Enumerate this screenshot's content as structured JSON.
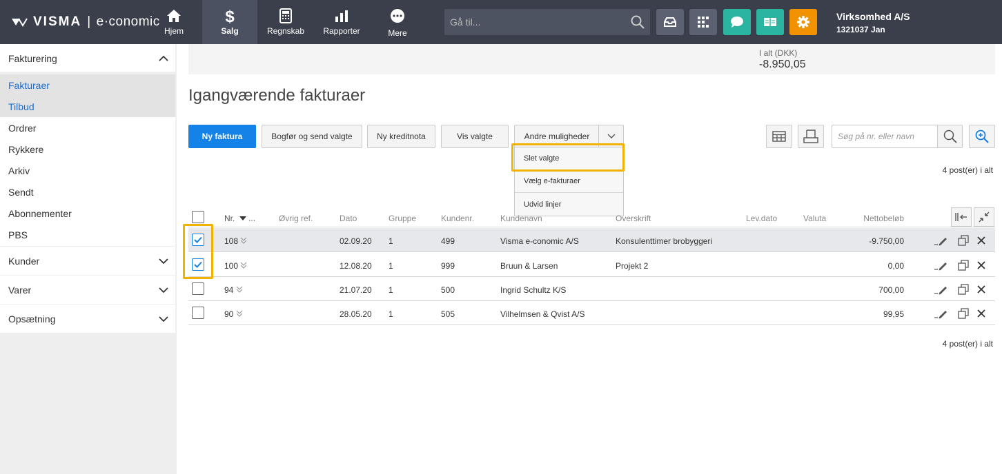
{
  "app": {
    "logo_brand": "VISMA",
    "logo_product": "e·conomic"
  },
  "topnav": {
    "items": [
      {
        "label": "Hjem",
        "icon": "home-icon"
      },
      {
        "label": "Salg",
        "icon": "dollar-icon"
      },
      {
        "label": "Regnskab",
        "icon": "calculator-icon"
      },
      {
        "label": "Rapporter",
        "icon": "bar-chart-icon"
      },
      {
        "label": "Mere",
        "icon": "more-icon"
      }
    ],
    "active": "Salg",
    "search_placeholder": "Gå til...",
    "tool_buttons": [
      {
        "icon": "inbox-icon",
        "color": "#5b6170"
      },
      {
        "icon": "apps-icon",
        "color": "#5b6170"
      },
      {
        "icon": "chat-icon",
        "color": "#2bb5a0"
      },
      {
        "icon": "book-icon",
        "color": "#2bb5a0"
      },
      {
        "icon": "gear-icon",
        "color": "#f39200"
      }
    ],
    "company_name": "Virksomhed A/S",
    "company_user": "1321037 Jan"
  },
  "sidebar": {
    "sections": [
      {
        "label": "Fakturering",
        "expanded": true
      },
      {
        "label": "Kunder",
        "expanded": false
      },
      {
        "label": "Varer",
        "expanded": false
      },
      {
        "label": "Opsætning",
        "expanded": false
      }
    ],
    "items": [
      {
        "label": "Fakturaer"
      },
      {
        "label": "Tilbud"
      },
      {
        "label": "Ordrer"
      },
      {
        "label": "Rykkere"
      },
      {
        "label": "Arkiv"
      },
      {
        "label": "Sendt"
      },
      {
        "label": "Abonnementer"
      },
      {
        "label": "PBS"
      }
    ]
  },
  "summary": {
    "label": "I alt (DKK)",
    "value": "-8.950,05"
  },
  "page": {
    "title": "Igangværende fakturaer"
  },
  "toolbar": {
    "new_invoice": "Ny faktura",
    "book_send": "Bogfør og send valgte",
    "new_credit": "Ny kreditnota",
    "show_selected": "Vis valgte",
    "other_options": "Andre muligheder",
    "search_placeholder": "Søg på nr. eller navn"
  },
  "dropdown": {
    "items": [
      "Slet valgte",
      "Vælg e-fakturaer",
      "Udvid linjer"
    ]
  },
  "count_text": "4 post(er) i alt",
  "table": {
    "headers": {
      "nr": "Nr.",
      "nr_more": "...",
      "ref": "Øvrig ref.",
      "date": "Dato",
      "group": "Gruppe",
      "custno": "Kundenr.",
      "custname": "Kundenavn",
      "heading": "Overskrift",
      "delivery": "Lev.dato",
      "currency": "Valuta",
      "net": "Nettobeløb"
    },
    "rows": [
      {
        "nr": "108",
        "date": "02.09.20",
        "group": "1",
        "custno": "499",
        "custname": "Visma e-conomic A/S",
        "heading": "Konsulenttimer brobyggeri",
        "net": "-9.750,00",
        "checked": true
      },
      {
        "nr": "100",
        "date": "12.08.20",
        "group": "1",
        "custno": "999",
        "custname": "Bruun & Larsen",
        "heading": "Projekt 2",
        "net": "0,00",
        "checked": true
      },
      {
        "nr": "94",
        "date": "21.07.20",
        "group": "1",
        "custno": "500",
        "custname": "Ingrid Schultz K/S",
        "heading": "",
        "net": "700,00",
        "checked": false
      },
      {
        "nr": "90",
        "date": "28.05.20",
        "group": "1",
        "custno": "505",
        "custname": "Vilhelmsen & Qvist A/S",
        "heading": "",
        "net": "99,95",
        "checked": false
      }
    ]
  },
  "colors": {
    "primary": "#1482e6",
    "highlight": "#f2b200",
    "topbar": "#3a3f4b"
  }
}
